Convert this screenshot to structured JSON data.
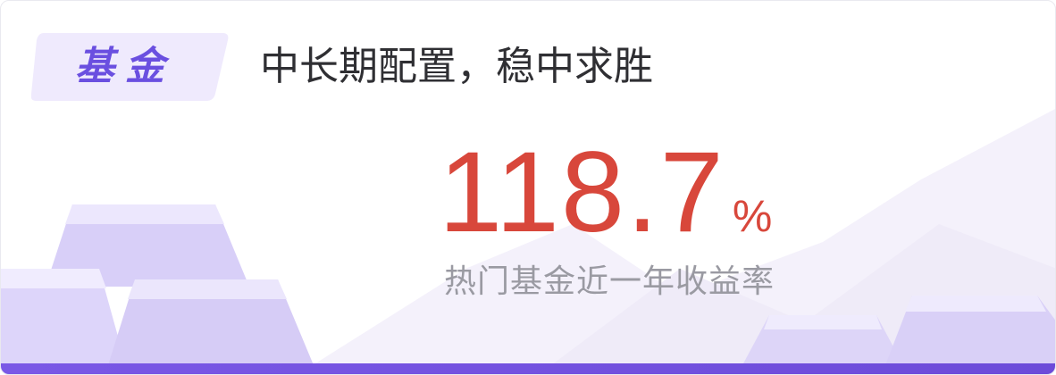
{
  "card": {
    "badge": {
      "label": "基金"
    },
    "slogan": "中长期配置，稳中求胜",
    "rate": {
      "value": "118.7",
      "unit": "%"
    },
    "caption": "热门基金近一年收益率"
  },
  "colors": {
    "accent": "#6a4fe0",
    "rate": "#d8473b",
    "caption": "#9a9aa2",
    "slogan": "#2f2f33",
    "badge_bg": "#efeafd",
    "bar": "#7a58e6"
  },
  "icons": [
    "gold-bars-illustration",
    "mountain-illustration"
  ]
}
